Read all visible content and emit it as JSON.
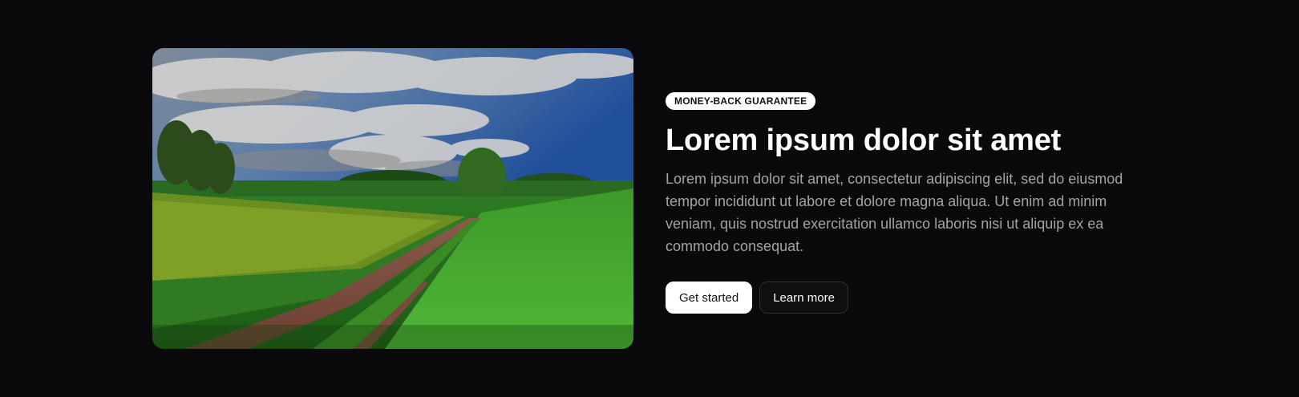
{
  "hero": {
    "image_alt": "Green countryside landscape with a dirt path, trees and a cloudy blue sky",
    "badge": "MONEY-BACK GUARANTEE",
    "title": "Lorem ipsum dolor sit amet",
    "description": "Lorem ipsum dolor sit amet, consectetur adipiscing elit, sed do eiusmod tempor incididunt ut labore et dolore magna aliqua. Ut enim ad minim veniam, quis nostrud exercitation ullamco laboris nisi ut aliquip ex ea commodo consequat.",
    "primary_button": "Get started",
    "secondary_button": "Learn more"
  },
  "colors": {
    "background": "#0a0a0c",
    "title": "#ffffff",
    "description": "#a3a3a8",
    "badge_bg": "#ffffff"
  }
}
